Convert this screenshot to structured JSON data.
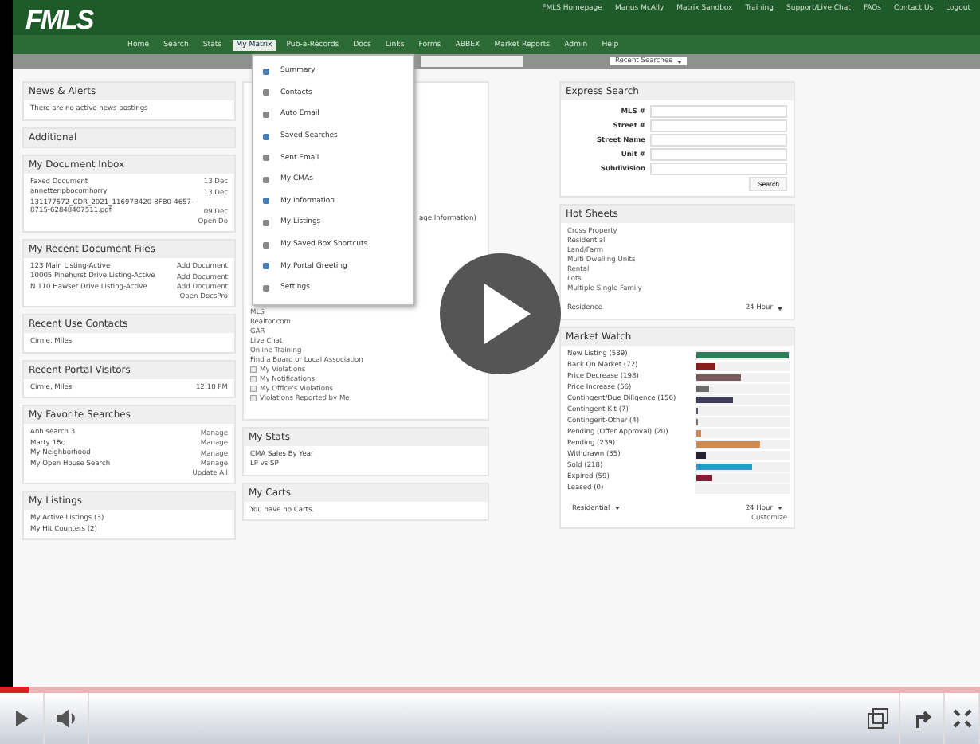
{
  "app": {
    "logo": "FMLS",
    "top_links": [
      "FMLS Homepage",
      "Manus McAlly",
      "Matrix Sandbox",
      "Training",
      "Support/Live Chat",
      "FAQs",
      "Contact Us",
      "Logout"
    ],
    "nav": [
      {
        "label": "Home",
        "selected": false
      },
      {
        "label": "Search",
        "selected": false
      },
      {
        "label": "Stats",
        "selected": false
      },
      {
        "label": "My Matrix",
        "selected": true
      },
      {
        "label": "Pub-a-Records",
        "selected": false
      },
      {
        "label": "Docs",
        "selected": false
      },
      {
        "label": "Links",
        "selected": false
      },
      {
        "label": "Forms",
        "selected": false
      },
      {
        "label": "ABBEX",
        "selected": false
      },
      {
        "label": "Market Reports",
        "selected": false
      },
      {
        "label": "Admin",
        "selected": false
      },
      {
        "label": "Help",
        "selected": false
      }
    ],
    "recent_select": "Recent Searches",
    "menu": [
      "Summary",
      "Contacts",
      "Auto Email",
      "Saved Searches",
      "Sent Email",
      "My CMAs",
      "My Information",
      "My Listings",
      "My Saved Box Shortcuts",
      "My Portal Greeting",
      "Settings"
    ],
    "left": [
      {
        "title": "News & Alerts",
        "lines": [
          {
            "text": "There are no active news postings"
          }
        ]
      },
      {
        "title": "Additional"
      },
      {
        "title": "My Document Inbox",
        "lines": [
          {
            "text": "Faxed Document",
            "aside": "13 Dec"
          },
          {
            "text": "annetteripbocomhorry",
            "aside": "13 Dec"
          },
          {
            "text": "131177572_CDR_2021_11697B420-8FB0-4657-8715-62848407511.pdf",
            "aside": "09 Dec"
          }
        ],
        "footer": "Open Do"
      },
      {
        "title": "My Recent Document Files",
        "lines": [
          {
            "text": "123 Main Listing-Active",
            "aside": "Add Document"
          },
          {
            "text": "10005 Pinehurst Drive Listing-Active",
            "aside": "Add Document"
          },
          {
            "text": "N 110 Hawser Drive Listing-Active",
            "aside": "Add Document"
          }
        ],
        "footer": "Open DocsPro"
      },
      {
        "title": "Recent Use Contacts",
        "lines": [
          {
            "text": "Cirnie, Miles"
          }
        ]
      },
      {
        "title": "Recent Portal Visitors",
        "lines": [
          {
            "text": "Cirnie, Miles",
            "aside": "12:18 PM"
          }
        ]
      },
      {
        "title": "My Favorite Searches",
        "lines": [
          {
            "text": "Anh search 3",
            "aside": "Manage"
          },
          {
            "text": "Marty 1Bc",
            "aside": "Manage"
          },
          {
            "text": "My Neighborhood",
            "aside": "Manage"
          },
          {
            "text": "My Open House Search",
            "aside": "Manage"
          }
        ],
        "footer": "Update All"
      },
      {
        "title": "My Listings",
        "lines": [
          {
            "text": "My Active Listings (3)"
          },
          {
            "text": "My Hit Counters (2)"
          }
        ]
      }
    ],
    "middle_fragment": "age Information)",
    "middle_links": [
      "MLS",
      "Realtor.com",
      "GAR",
      "Live Chat",
      "Online Training",
      "Find a Board or Local Association"
    ],
    "violations": [
      "My Violations",
      "My Notifications",
      "My Office's Violations",
      "Violations Reported by Me"
    ],
    "middle": [
      {
        "title": "My Stats",
        "lines": [
          "CMA Sales By Year",
          "LP vs SP"
        ]
      },
      {
        "title": "My Carts",
        "lines": [
          "You have no Carts."
        ]
      }
    ],
    "express": {
      "title": "Express Search",
      "fields": [
        "MLS #",
        "Street #",
        "Street Name",
        "Unit #",
        "Subdivision"
      ],
      "button": "Search"
    },
    "hot": {
      "title": "Hot Sheets",
      "lines": [
        "Cross Property",
        "Residential",
        "Land/Farm",
        "Multi Dwelling Units",
        "Rental",
        "Lots",
        "Multiple Single Family"
      ],
      "select_label": "Residence",
      "select": "24 Hour"
    },
    "market": {
      "title": "Market Watch",
      "items": [
        {
          "label": "New Listing (539)",
          "level": 1,
          "color": "#2e7d5b"
        },
        {
          "label": "Back On Market (72)",
          "level": 0.2,
          "color": "#8b1a1a"
        },
        {
          "label": "Price Decrease (198)",
          "level": 0.49,
          "color": "#7a5a5a"
        },
        {
          "label": "Price Increase (56)",
          "level": 0.14,
          "color": "#6a6a6a"
        },
        {
          "label": "Contingent/Due Diligence (156)",
          "level": 0.39,
          "color": "#3e3e5a"
        },
        {
          "label": "Contingent-Kit (7)",
          "level": 0.02,
          "color": "#555577"
        },
        {
          "label": "Contingent-Other (4)",
          "level": 0.01,
          "color": "#777777"
        },
        {
          "label": "Pending (Offer Approval) (20)",
          "level": 0.05,
          "color": "#d08a50"
        },
        {
          "label": "Pending (239)",
          "level": 0.69,
          "color": "#d08a50"
        },
        {
          "label": "Withdrawn (35)",
          "level": 0.1,
          "color": "#222233"
        },
        {
          "label": "Sold (218)",
          "level": 0.61,
          "color": "#2a9ac8"
        },
        {
          "label": "Expired (59)",
          "level": 0.17,
          "color": "#8b1a3a"
        },
        {
          "label": "Leased (0)"
        }
      ],
      "select": "Residential",
      "period": "24 Hour",
      "link": "Customize"
    }
  },
  "player": {
    "progress": {
      "level": 0.03
    }
  }
}
